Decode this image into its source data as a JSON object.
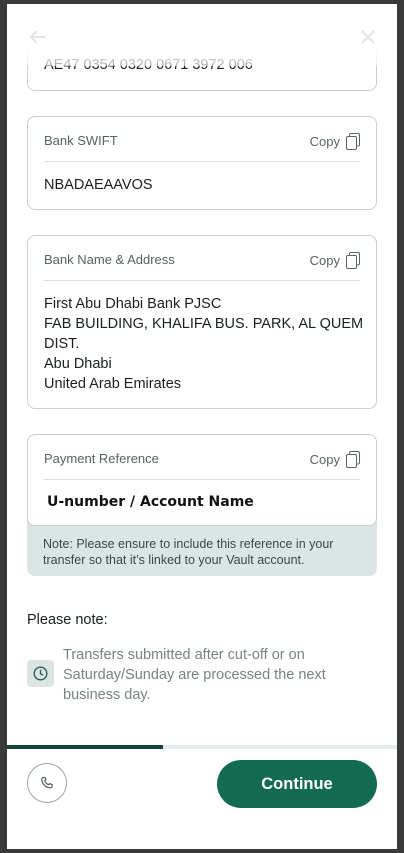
{
  "iban": {
    "value": "AE47 0354 0320 0671 3972 006"
  },
  "swift": {
    "label": "Bank SWIFT",
    "copy_label": "Copy",
    "value": "NBADAEAAVOS"
  },
  "bank": {
    "label": "Bank Name & Address",
    "copy_label": "Copy",
    "lines": [
      "First Abu Dhabi Bank PJSC",
      "FAB BUILDING, KHALIFA BUS. PARK, AL QUEM",
      "DIST.",
      "Abu Dhabi",
      "United Arab Emirates"
    ]
  },
  "reference": {
    "label": "Payment Reference",
    "copy_label": "Copy",
    "value": "U-number / Account Name",
    "note": "Note: Please ensure to include this reference in your transfer so that it’s linked to your Vault account."
  },
  "please_note": {
    "heading": "Please note:",
    "text": "Transfers submitted after cut-off or on Saturday/Sunday are processed the next business day."
  },
  "progress": {
    "fraction": 0.4
  },
  "footer": {
    "continue_label": "Continue"
  },
  "colors": {
    "accent": "#136b52",
    "note_bg": "#dbe6e4",
    "progress": "#14433b"
  },
  "icons": [
    "back-arrow-icon",
    "close-icon",
    "copy-icon",
    "clock-icon",
    "phone-icon"
  ]
}
